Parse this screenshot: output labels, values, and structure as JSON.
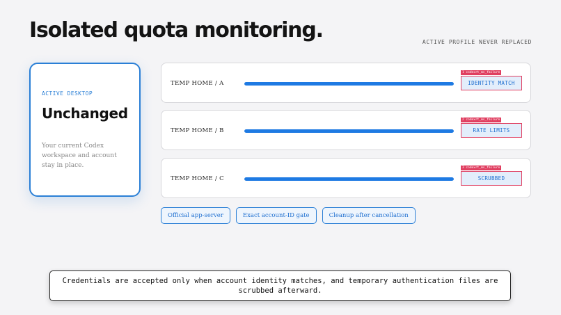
{
  "header": {
    "title": "Isolated quota monitoring.",
    "subtitle": "ACTIVE PROFILE NEVER REPLACED"
  },
  "active_desktop": {
    "kicker": "ACTIVE DESKTOP",
    "heading": "Unchanged",
    "body": "Your current Codex workspace and account stay in place."
  },
  "rows": [
    {
      "label": "TEMP HOME / A",
      "progress": 1.0,
      "badge_tag": "1 codexrt_ms_failure",
      "badge": "IDENTITY MATCH"
    },
    {
      "label": "TEMP HOME / B",
      "progress": 1.0,
      "badge_tag": "2 codexrt_ms_failure",
      "badge": "RATE LIMITS"
    },
    {
      "label": "TEMP HOME / C",
      "progress": 1.0,
      "badge_tag": "3 codexrt_ms_failure",
      "badge": "SCRUBBED"
    }
  ],
  "chips": [
    "Official app-server",
    "Exact account-ID gate",
    "Cleanup after cancellation"
  ],
  "caption": "Credentials are accepted only when account identity matches, and temporary authentication files are scrubbed afterward.",
  "colors": {
    "accent": "#1e7ae3",
    "alert": "#e03e60",
    "background": "#f4f4f6"
  }
}
